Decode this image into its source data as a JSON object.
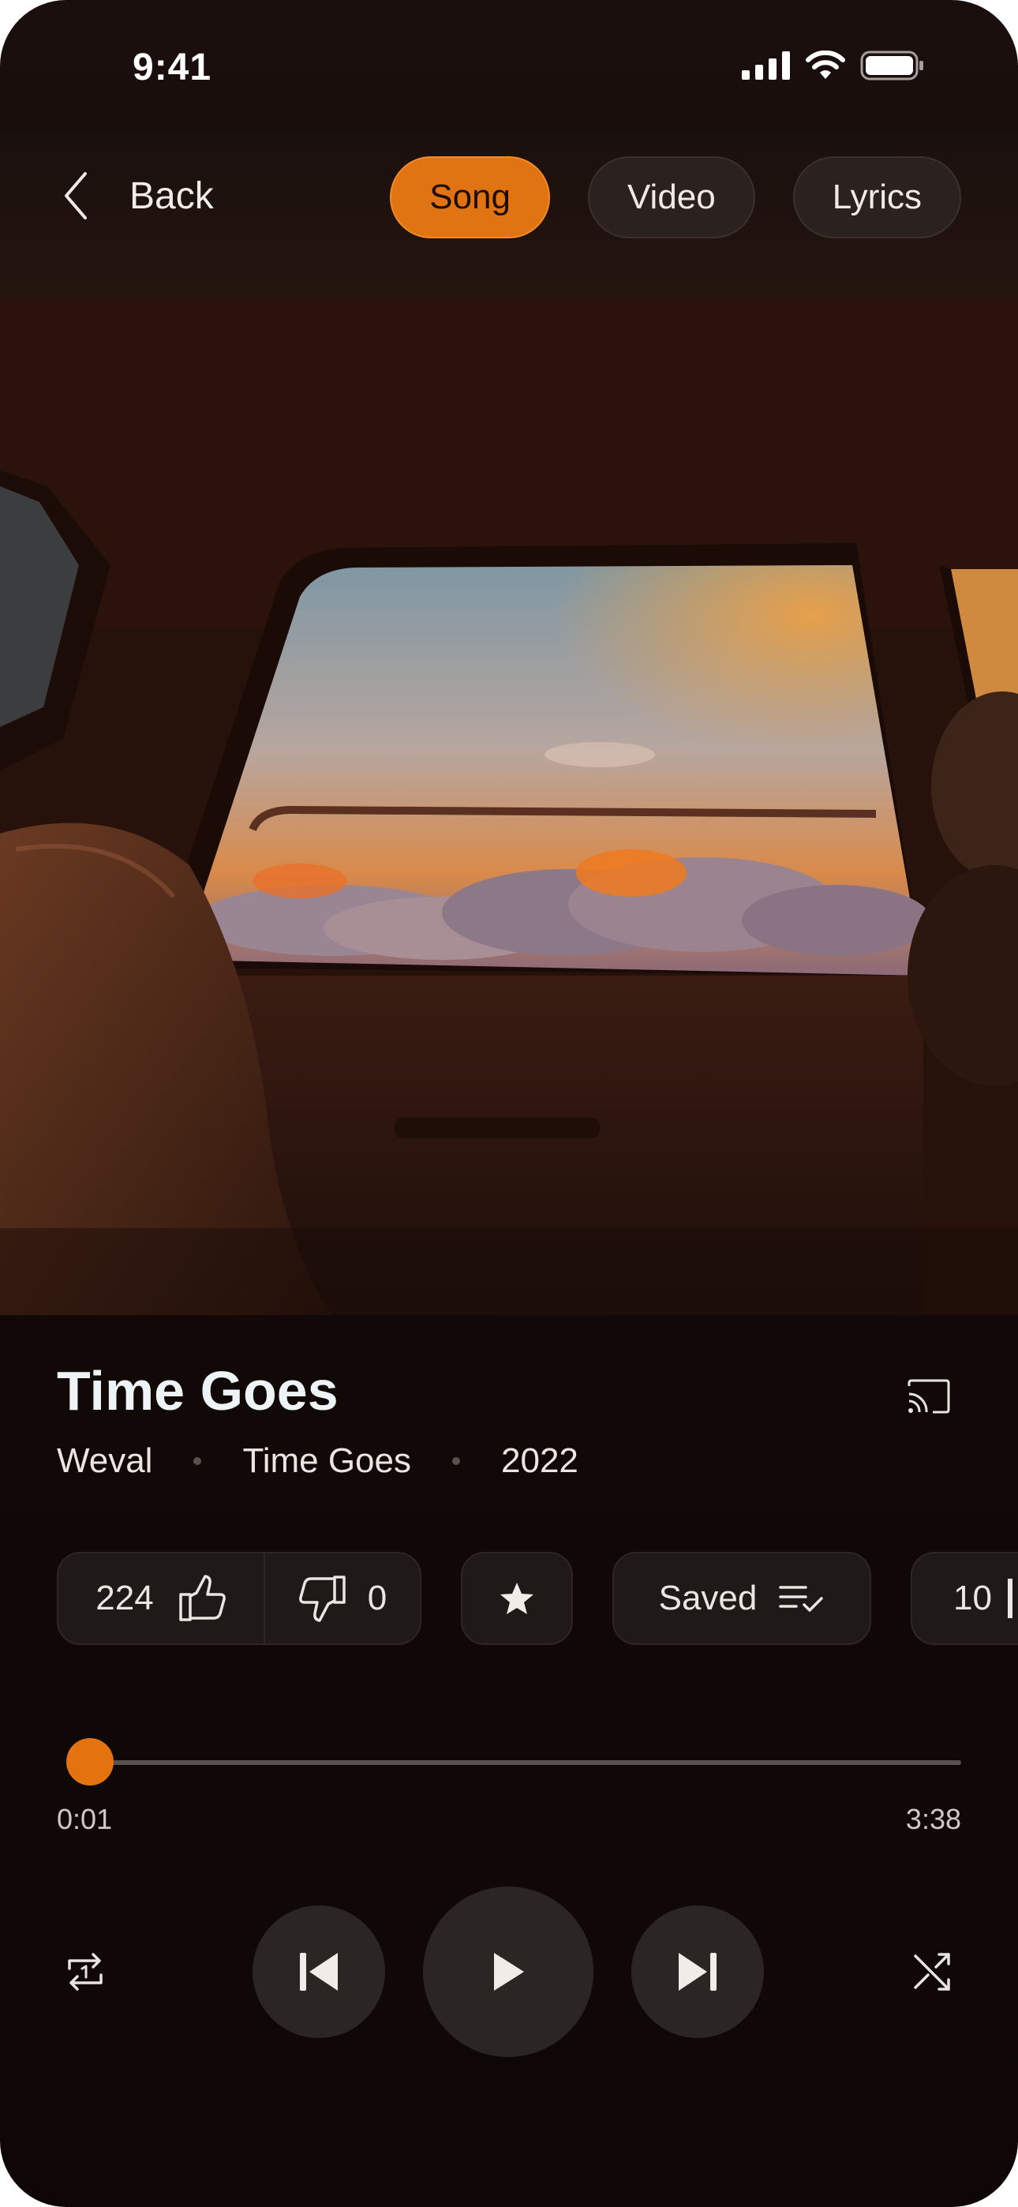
{
  "status_bar": {
    "time": "9:41"
  },
  "header": {
    "back_label": "Back",
    "tabs": [
      {
        "label": "Song",
        "active": true
      },
      {
        "label": "Video",
        "active": false
      },
      {
        "label": "Lyrics",
        "active": false
      }
    ]
  },
  "song": {
    "title": "Time Goes",
    "artist": "Weval",
    "album": "Time Goes",
    "year": "2022"
  },
  "actions": {
    "likes": "224",
    "dislikes": "0",
    "saved_label": "Saved",
    "more_count": "10"
  },
  "progress": {
    "current": "0:01",
    "total": "3:38",
    "fraction": 0.005
  },
  "colors": {
    "accent": "#e3720f",
    "background": "#120a08"
  },
  "icons": [
    "back-chevron-icon",
    "cast-icon",
    "thumbs-up-icon",
    "thumbs-down-icon",
    "star-icon",
    "playlist-check-icon",
    "repeat-one-icon",
    "previous-icon",
    "play-icon",
    "next-icon",
    "shuffle-icon"
  ]
}
